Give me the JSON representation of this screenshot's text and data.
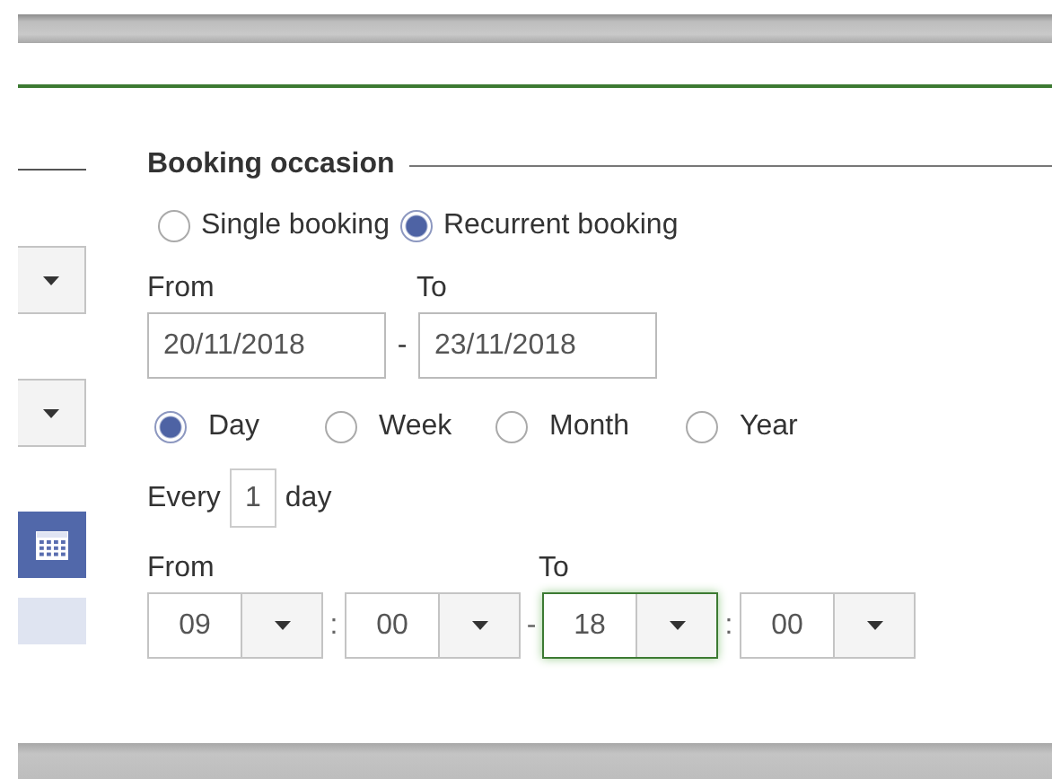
{
  "section": {
    "title": "Booking occasion"
  },
  "booking_types": [
    {
      "label": "Single booking",
      "selected": false
    },
    {
      "label": "Recurrent booking",
      "selected": true
    }
  ],
  "date_range": {
    "from_label": "From",
    "to_label": "To",
    "from": "20/11/2018",
    "separator": "-",
    "to": "23/11/2018"
  },
  "periods": [
    {
      "label": "Day",
      "selected": true
    },
    {
      "label": "Week",
      "selected": false
    },
    {
      "label": "Month",
      "selected": false
    },
    {
      "label": "Year",
      "selected": false
    }
  ],
  "every": {
    "label": "Every",
    "value": "1",
    "unit": "day"
  },
  "time_range": {
    "from_label": "From",
    "to_label": "To",
    "separators": [
      ":",
      "-",
      ":"
    ],
    "fields": [
      {
        "value": "09",
        "focused": false
      },
      {
        "value": "00",
        "focused": false
      },
      {
        "value": "18",
        "focused": true
      },
      {
        "value": "00",
        "focused": false
      }
    ]
  }
}
